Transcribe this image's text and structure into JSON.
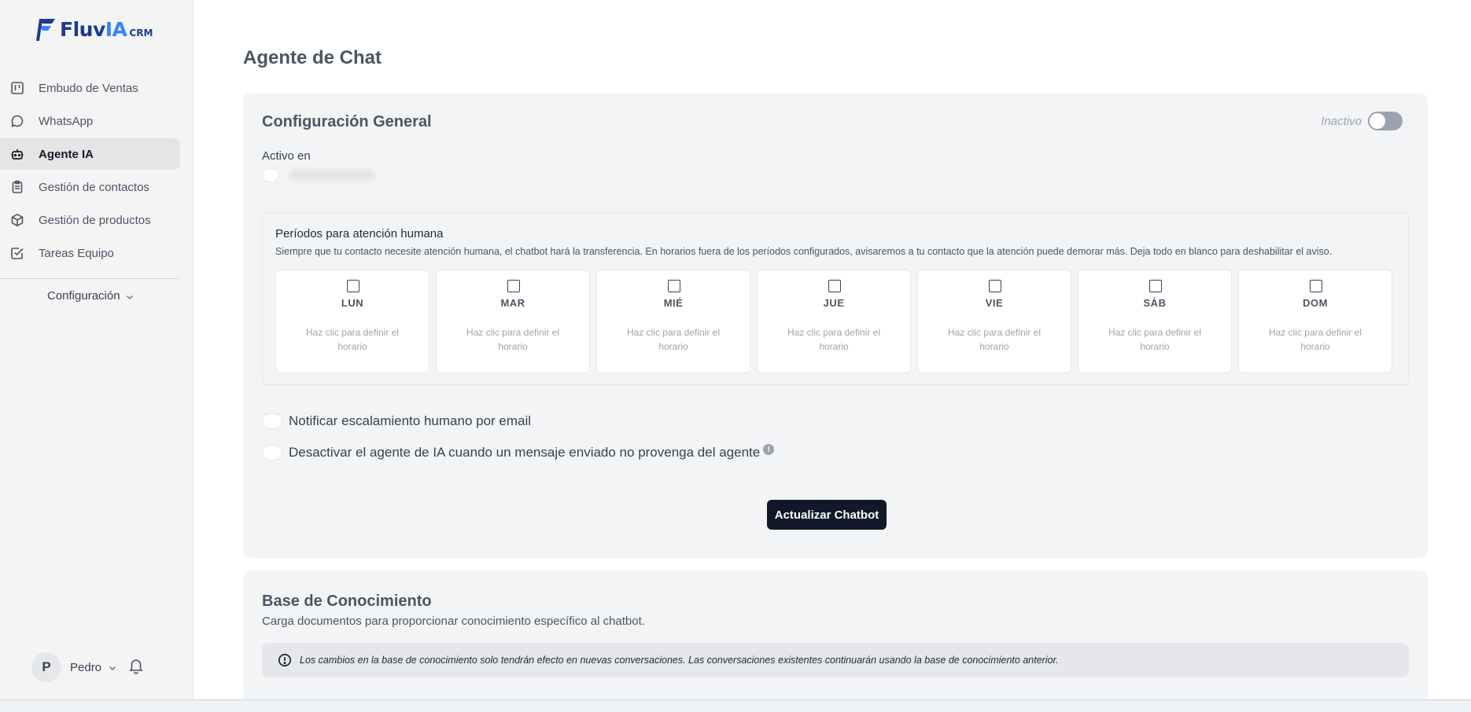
{
  "brand": {
    "name_main": "Fluv",
    "name_accent": "IA",
    "name_suffix": "CRM"
  },
  "sidebar": {
    "items": [
      {
        "label": "Embudo de Ventas",
        "icon": "kanban-icon"
      },
      {
        "label": "WhatsApp",
        "icon": "chat-bubble-icon"
      },
      {
        "label": "Agente IA",
        "icon": "robot-icon",
        "active": true
      },
      {
        "label": "Gestión de contactos",
        "icon": "clipboard-icon"
      },
      {
        "label": "Gestión de productos",
        "icon": "package-icon"
      },
      {
        "label": "Tareas Equipo",
        "icon": "check-square-icon"
      }
    ],
    "config_label": "Configuración"
  },
  "user": {
    "initial": "P",
    "name": "Pedro"
  },
  "page": {
    "title": "Agente de Chat"
  },
  "general": {
    "title": "Configuración General",
    "status_label": "Inactivo",
    "active_on_label": "Activo en",
    "periods": {
      "title": "Períodos para atención humana",
      "description": "Siempre que tu contacto necesite atención humana, el chatbot hará la transferencia. En horarios fuera de los períodos configurados, avisaremos a tu contacto que la atención puede demorar más. Deja todo en blanco para deshabilitar el aviso.",
      "days": [
        {
          "name": "LUN",
          "hint": "Haz clic para definir el horario"
        },
        {
          "name": "MAR",
          "hint": "Haz clic para definir el horario"
        },
        {
          "name": "MIÉ",
          "hint": "Haz clic para definir el horario"
        },
        {
          "name": "JUE",
          "hint": "Haz clic para definir el horario"
        },
        {
          "name": "VIE",
          "hint": "Haz clic para definir el horario"
        },
        {
          "name": "SÁB",
          "hint": "Haz clic para definir el horario"
        },
        {
          "name": "DOM",
          "hint": "Haz clic para definir el horario"
        }
      ]
    },
    "notify_email_label": "Notificar escalamiento humano por email",
    "deactivate_label": "Desactivar el agente de IA cuando un mensaje enviado no provenga del agente",
    "update_button": "Actualizar Chatbot"
  },
  "knowledge": {
    "title": "Base de Conocimiento",
    "description": "Carga documentos para proporcionar conocimiento específico al chatbot.",
    "notice": "Los cambios en la base de conocimiento solo tendrán efecto en nuevas conversaciones. Las conversaciones existentes continuarán usando la base de conocimiento anterior."
  },
  "colors": {
    "primary": "#111827",
    "brand_dark": "#1e3a8a",
    "brand_light": "#3b82f6",
    "sidebar_bg": "#f4f4f5",
    "card_bg": "#f3f4f6"
  }
}
